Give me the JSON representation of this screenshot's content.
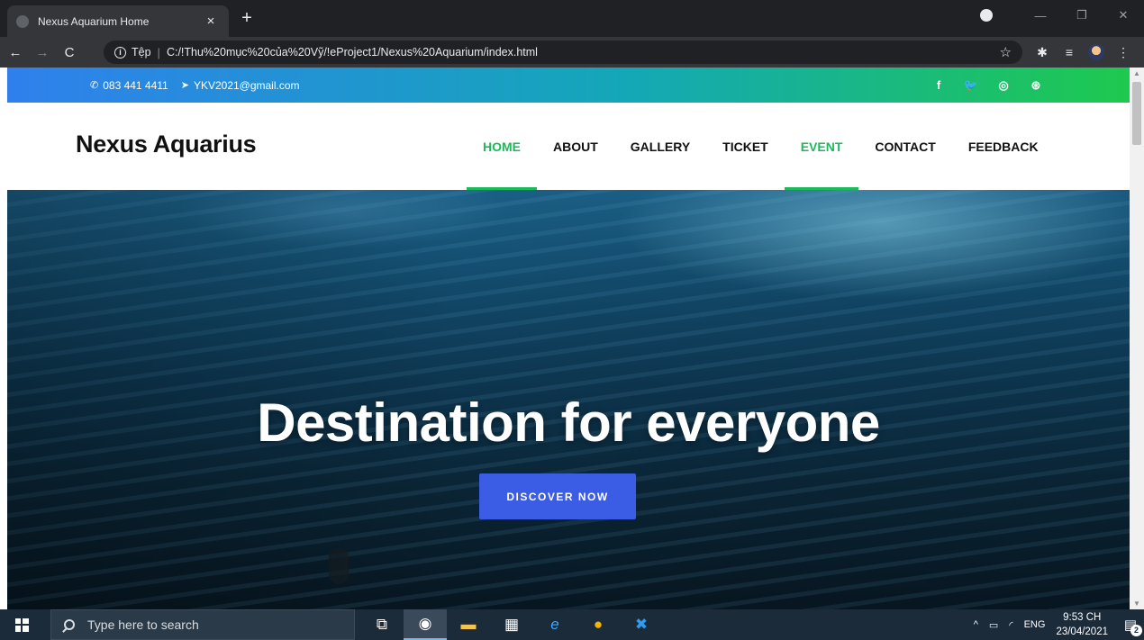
{
  "browser": {
    "tab_title": "Nexus Aquarium Home",
    "tab_close": "×",
    "new_tab": "+",
    "url_scheme": "Tệp",
    "url": "C:/!Thu%20mục%20của%20Vỹ/!eProject1/Nexus%20Aquarium/index.html",
    "win_min": "—",
    "win_restore": "❐",
    "win_close": "✕"
  },
  "site": {
    "phone": "083 441 4411",
    "email": "YKV2021@gmail.com",
    "social": [
      "f",
      "🐦",
      "◎",
      "⊛"
    ],
    "brand": "Nexus Aquarius",
    "nav": [
      {
        "label": "HOME",
        "active": true
      },
      {
        "label": "ABOUT",
        "active": false
      },
      {
        "label": "GALLERY",
        "active": false
      },
      {
        "label": "TICKET",
        "active": false
      },
      {
        "label": "EVENT",
        "active": true
      },
      {
        "label": "CONTACT",
        "active": false
      },
      {
        "label": "FEEDBACK",
        "active": false
      }
    ],
    "hero_title": "Destination for everyone",
    "cta_label": "DISCOVER NOW"
  },
  "taskbar": {
    "search_placeholder": "Type here to search",
    "language": "ENG",
    "time": "9:53 CH",
    "date": "23/04/2021",
    "notification_count": "2"
  }
}
